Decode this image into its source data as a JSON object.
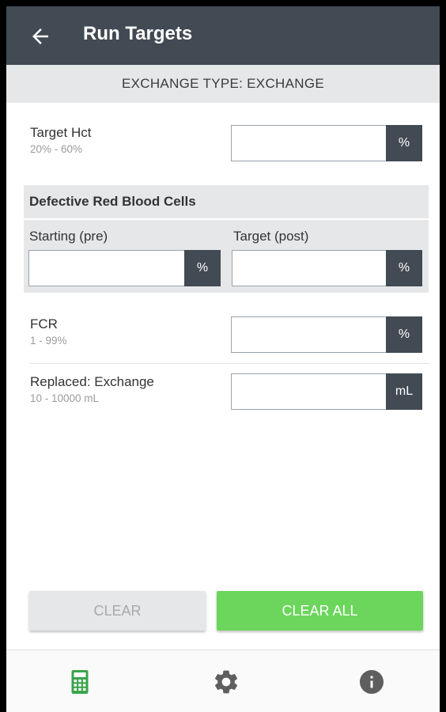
{
  "appbar": {
    "title": "Run Targets",
    "back_icon": "arrow-left-icon"
  },
  "exchange_type": "EXCHANGE TYPE: EXCHANGE",
  "target_hct": {
    "label": "Target Hct",
    "range": "20% - 60%",
    "value": "",
    "unit": "%"
  },
  "defective_rbc": {
    "heading": "Defective Red Blood Cells",
    "starting": {
      "label": "Starting (pre)",
      "value": "",
      "unit": "%"
    },
    "target": {
      "label": "Target (post)",
      "value": "",
      "unit": "%"
    }
  },
  "fcr": {
    "label": "FCR",
    "range": "1 - 99%",
    "value": "",
    "unit": "%"
  },
  "replaced": {
    "label": "Replaced: Exchange",
    "range": "10 - 10000 mL",
    "value": "",
    "unit": "mL"
  },
  "buttons": {
    "clear": "CLEAR",
    "clear_all": "CLEAR ALL"
  },
  "bottom_nav": {
    "items": [
      {
        "icon": "calculator-icon",
        "active": true
      },
      {
        "icon": "gear-icon",
        "active": false
      },
      {
        "icon": "info-icon",
        "active": false
      }
    ]
  },
  "colors": {
    "appbar": "#424a54",
    "accent_green": "#6cd65c",
    "active_icon": "#3aa34a",
    "inactive_icon": "#5e5e5e"
  }
}
